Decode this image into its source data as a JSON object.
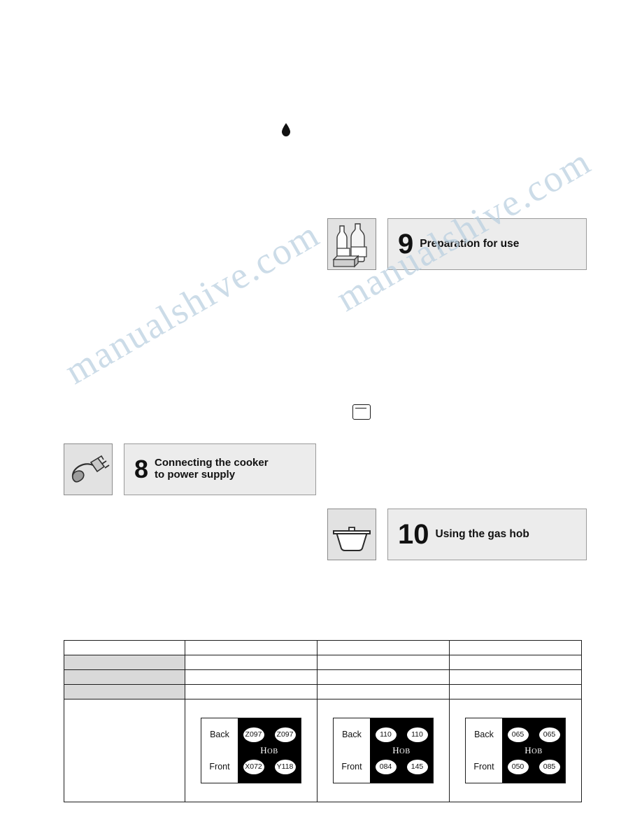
{
  "watermark": {
    "line1": "manualshive.com",
    "line2": "manualshive.com"
  },
  "icons": {
    "drop": "drop-icon",
    "tiny_box": "display-panel-icon",
    "bottles": "bottles-icon",
    "plug": "power-plug-icon",
    "pot": "cooking-pot-icon"
  },
  "sections": [
    {
      "number": "9",
      "title": "Preparation for use",
      "icon": "bottles-icon"
    },
    {
      "number": "8",
      "title_line1": "Connecting the cooker",
      "title_line2": "to power supply",
      "icon": "power-plug-icon"
    },
    {
      "number": "10",
      "title": "Using the gas hob",
      "icon": "cooking-pot-icon"
    }
  ],
  "table": {
    "rows": [
      {
        "cells": [
          "",
          "",
          "",
          ""
        ],
        "shaded": false
      },
      {
        "cells": [
          "",
          "",
          "",
          ""
        ],
        "shaded": true
      },
      {
        "cells": [
          "",
          "",
          "",
          ""
        ],
        "shaded": true
      },
      {
        "cells": [
          "",
          "",
          "",
          ""
        ],
        "shaded": true
      }
    ],
    "hobs": [
      {
        "label_back": "Back",
        "label_front": "Front",
        "word": "Hob",
        "burners": [
          "Z097",
          "Z097",
          "X072",
          "Y118"
        ]
      },
      {
        "label_back": "Back",
        "label_front": "Front",
        "word": "Hob",
        "burners": [
          "110",
          "110",
          "084",
          "145"
        ]
      },
      {
        "label_back": "Back",
        "label_front": "Front",
        "word": "Hob",
        "burners": [
          "065",
          "065",
          "050",
          "085"
        ]
      }
    ]
  }
}
